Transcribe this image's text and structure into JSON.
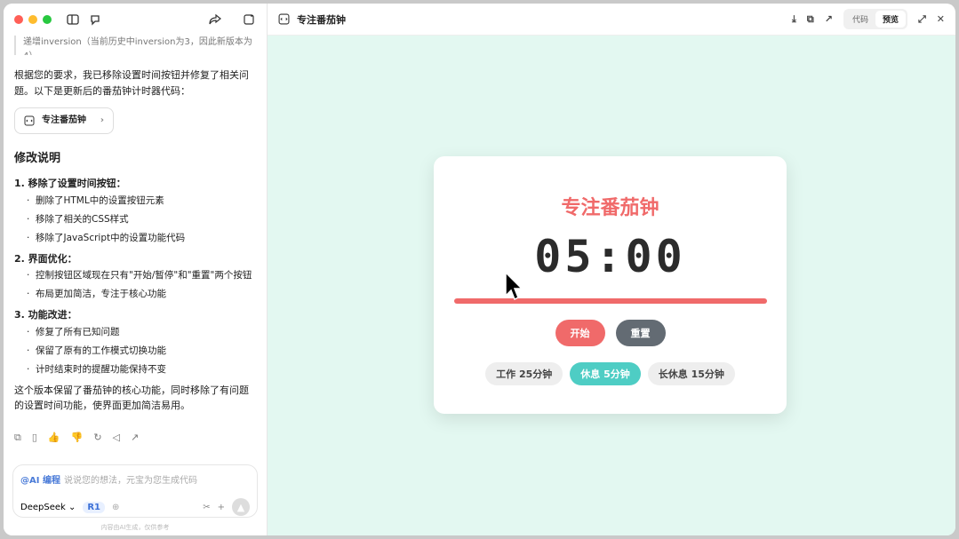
{
  "left": {
    "faded_text": "递增inversion（当前历史中inversion为3，因此新版本为4）。",
    "intro": "根据您的要求，我已移除设置时间按钮并修复了相关问题。以下是更新后的番茄钟计时器代码：",
    "card_label": "专注番茄钟",
    "heading": "修改说明",
    "sections": [
      {
        "title": "1. 移除了设置时间按钮：",
        "items": [
          "删除了HTML中的设置按钮元素",
          "移除了相关的CSS样式",
          "移除了JavaScript中的设置功能代码"
        ]
      },
      {
        "title": "2. 界面优化：",
        "items": [
          "控制按钮区域现在只有\"开始/暂停\"和\"重置\"两个按钮",
          "布局更加简洁，专注于核心功能"
        ]
      },
      {
        "title": "3. 功能改进：",
        "items": [
          "修复了所有已知问题",
          "保留了原有的工作模式切换功能",
          "计时结束时的提醒功能保持不变"
        ]
      }
    ],
    "summary": "这个版本保留了番茄钟的核心功能，同时移除了有问题的设置时间功能，使界面更加简洁易用。",
    "composer": {
      "ai_tag": "@AI 编程",
      "placeholder": "说说您的想法，元宝为您生成代码",
      "model": "DeepSeek ⌄",
      "r1": "R1"
    },
    "footer": "内容由AI生成，仅供参考"
  },
  "right": {
    "title": "专注番茄钟",
    "tab_code": "代码",
    "tab_preview": "预览"
  },
  "pomodoro": {
    "title": "专注番茄钟",
    "time": "05:00",
    "progress": 1.0,
    "start_label": "开始",
    "reset_label": "重置",
    "modes": [
      "工作 25分钟",
      "休息 5分钟",
      "长休息 15分钟"
    ],
    "active_mode": 1
  },
  "colors": {
    "accent": "#f06a6a",
    "reset": "#636b73",
    "active_mode": "#4ecdc4",
    "preview_bg": "#e3f8f1"
  }
}
